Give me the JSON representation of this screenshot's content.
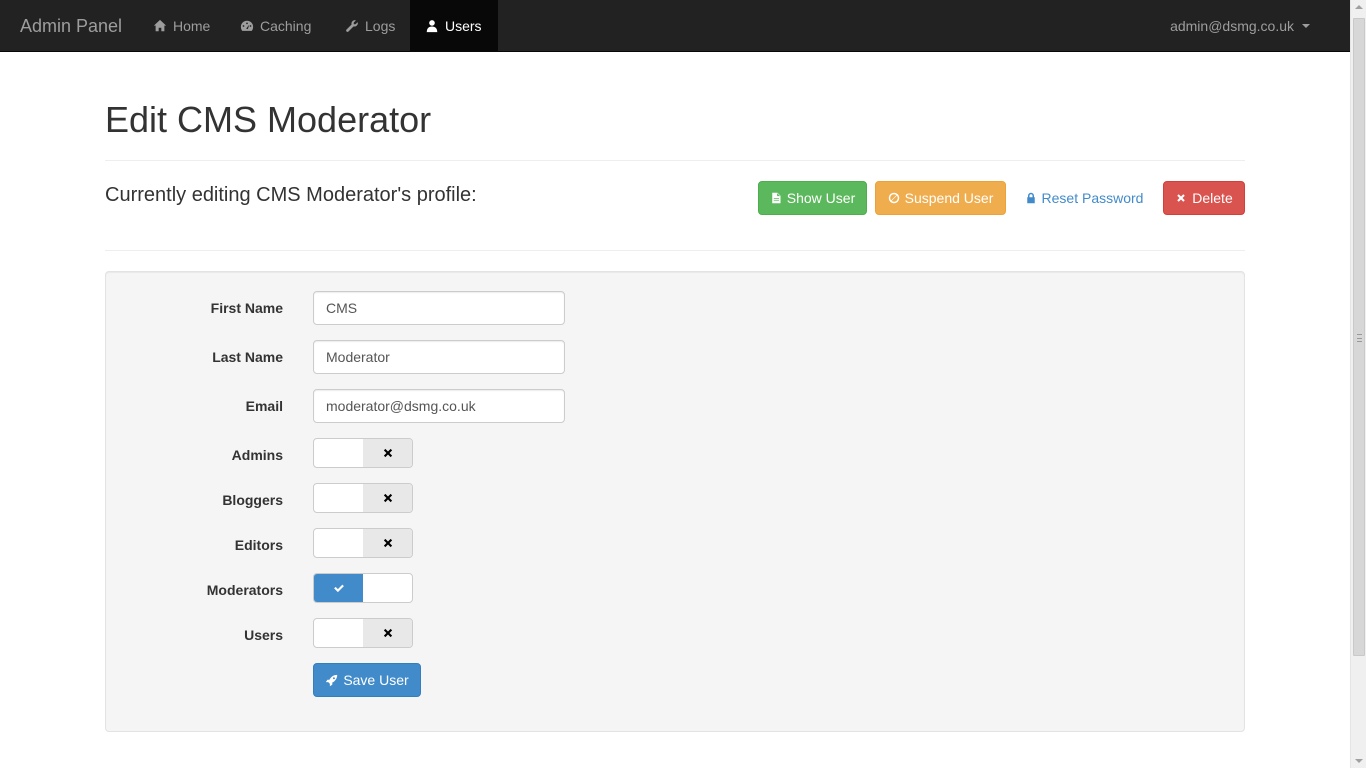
{
  "navbar": {
    "brand": "Admin Panel",
    "items": [
      {
        "label": "Home",
        "icon": "home-icon"
      },
      {
        "label": "Caching",
        "icon": "dashboard-icon"
      },
      {
        "label": "Logs",
        "icon": "wrench-icon"
      },
      {
        "label": "Users",
        "icon": "user-icon",
        "active": true
      }
    ],
    "user_email": "admin@dsmg.co.uk"
  },
  "page": {
    "title": "Edit CMS Moderator",
    "subtitle": "Currently editing CMS Moderator's profile:"
  },
  "actions": {
    "show_user": "Show User",
    "suspend_user": "Suspend User",
    "reset_password": "Reset Password",
    "delete": "Delete"
  },
  "form": {
    "first_name": {
      "label": "First Name",
      "value": "CMS"
    },
    "last_name": {
      "label": "Last Name",
      "value": "Moderator"
    },
    "email": {
      "label": "Email",
      "value": "moderator@dsmg.co.uk"
    },
    "groups": [
      {
        "label": "Admins",
        "checked": false
      },
      {
        "label": "Bloggers",
        "checked": false
      },
      {
        "label": "Editors",
        "checked": false
      },
      {
        "label": "Moderators",
        "checked": true
      },
      {
        "label": "Users",
        "checked": false
      }
    ],
    "save_label": "Save User"
  },
  "colors": {
    "navbar_bg": "#222222",
    "success": "#5cb85c",
    "warning": "#f0ad4e",
    "danger": "#d9534f",
    "primary": "#428bca",
    "link": "#428bca"
  }
}
